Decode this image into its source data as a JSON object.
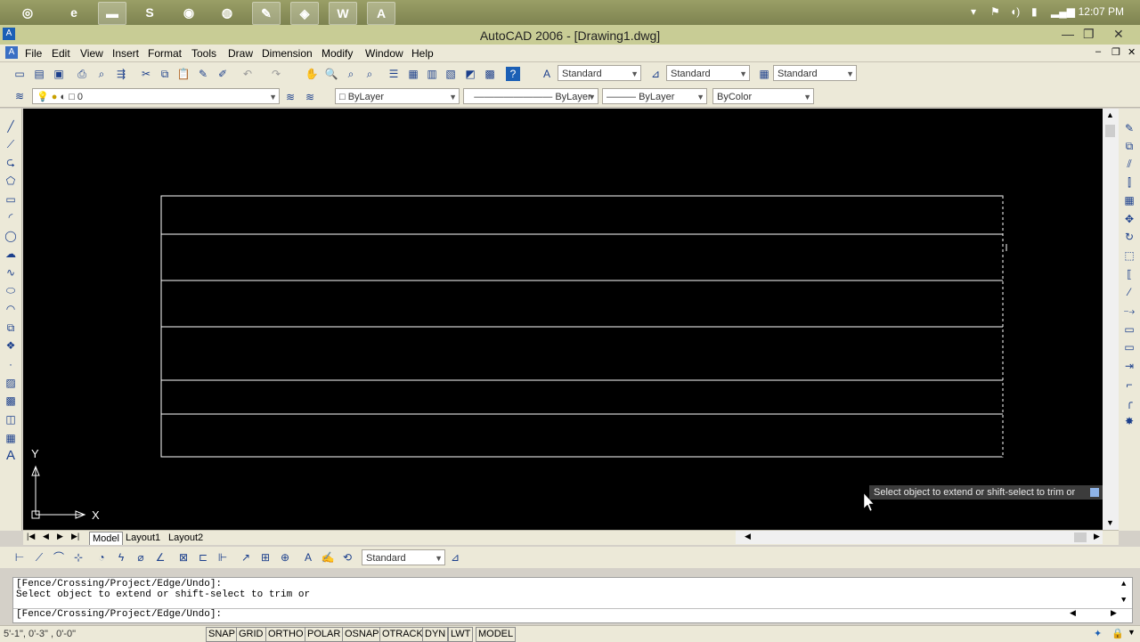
{
  "taskbar": {
    "clock": "12:07 PM",
    "apps": [
      {
        "icon": "start-orb-icon",
        "glyph": "◎"
      },
      {
        "icon": "internet-explorer-icon",
        "glyph": "e"
      },
      {
        "icon": "file-explorer-icon",
        "glyph": "▬"
      },
      {
        "icon": "skype-icon",
        "glyph": "S"
      },
      {
        "icon": "chrome-icon",
        "glyph": "◉"
      },
      {
        "icon": "firefox-icon",
        "glyph": "◍"
      },
      {
        "icon": "paint-tool-icon",
        "glyph": "✎"
      },
      {
        "icon": "security-shield-icon",
        "glyph": "◈"
      },
      {
        "icon": "word-icon",
        "glyph": "W"
      },
      {
        "icon": "autocad-taskbar-icon",
        "glyph": "A"
      }
    ]
  },
  "window": {
    "title": "AutoCAD 2006 - [Drawing1.dwg]"
  },
  "menu": [
    "File",
    "Edit",
    "View",
    "Insert",
    "Format",
    "Tools",
    "Draw",
    "Dimension",
    "Modify",
    "Window",
    "Help"
  ],
  "styles_toolbar": {
    "text_style": "Standard",
    "dim_style": "Standard",
    "table_style": "Standard"
  },
  "layers_toolbar": {
    "layer": "0",
    "color": "ByLayer",
    "linetype": "ByLayer",
    "lineweight": "ByLayer",
    "plotstyle": "ByColor"
  },
  "canvas": {
    "colors": {
      "background": "#000000",
      "lines": "#ffffff"
    },
    "ucs": {
      "y_label": "Y",
      "x_label": "X"
    },
    "tooltip": "Select object to extend or shift-select to trim or"
  },
  "layout_tabs": [
    "Model",
    "Layout1",
    "Layout2"
  ],
  "dim_toolbar": {
    "dim_style": "Standard"
  },
  "command": {
    "history": [
      "[Fence/Crossing/Project/Edge/Undo]:",
      "Select object to extend or shift-select to trim or"
    ],
    "prompt": "[Fence/Crossing/Project/Edge/Undo]:"
  },
  "status": {
    "coordinates": "5'-1\",  0'-3\" , 0'-0\"",
    "toggles": [
      "SNAP",
      "GRID",
      "ORTHO",
      "POLAR",
      "OSNAP",
      "OTRACK",
      "DYN",
      "LWT",
      "MODEL"
    ]
  }
}
